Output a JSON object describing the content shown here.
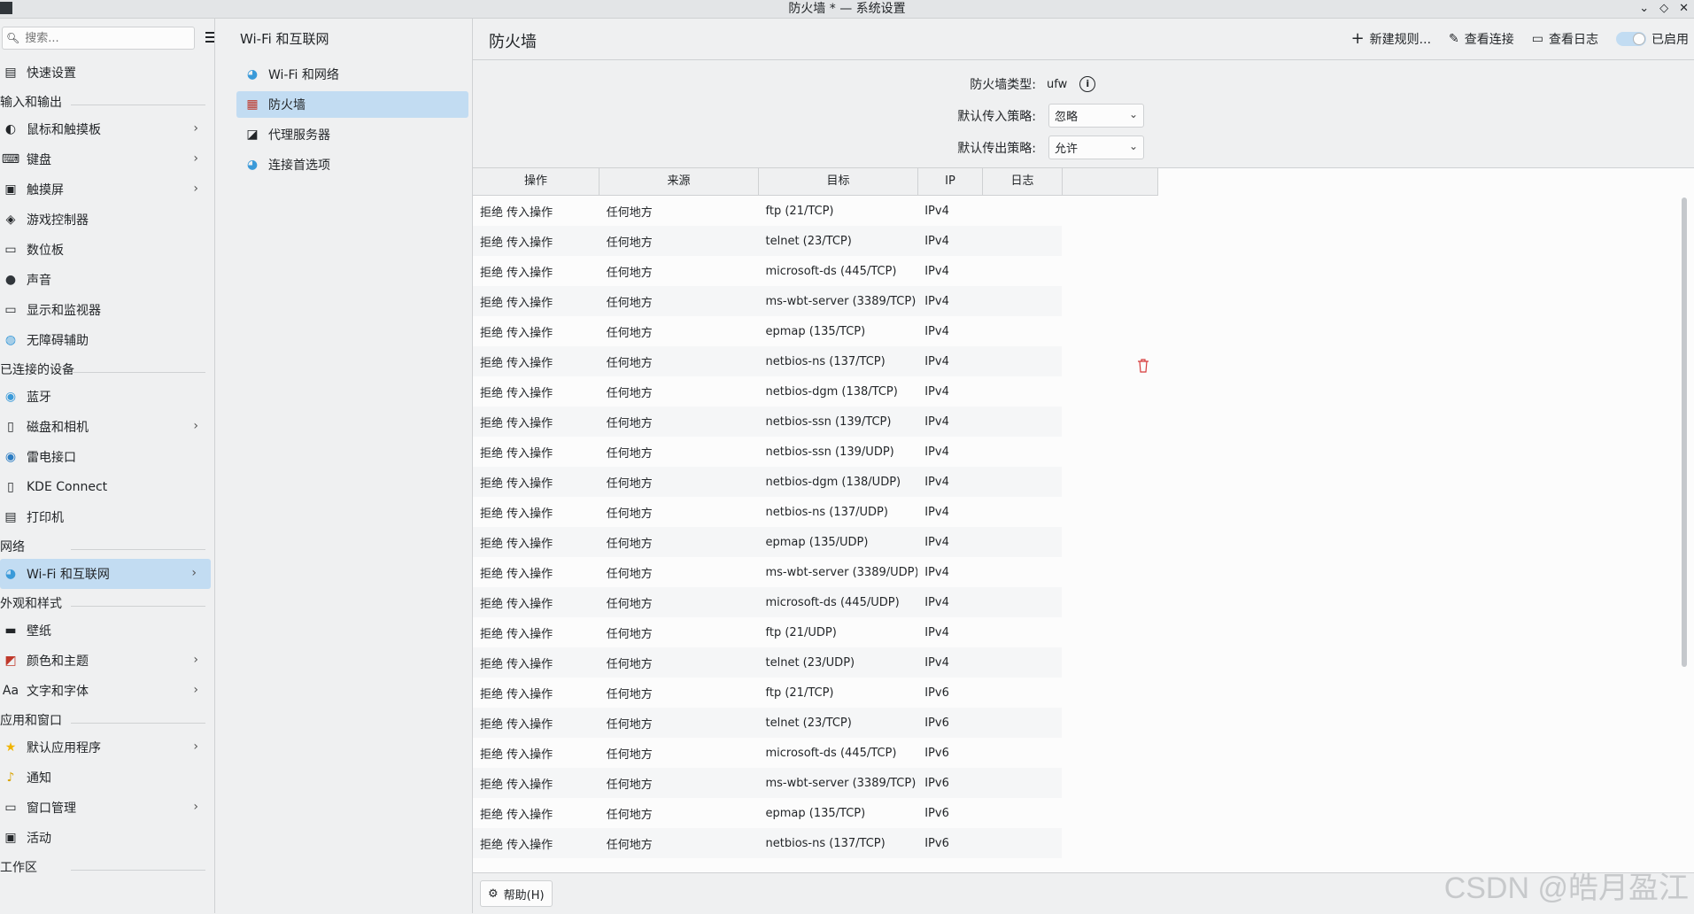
{
  "window": {
    "title": "防火墙 * — 系统设置"
  },
  "sidebar": {
    "search_placeholder": "搜索...",
    "items": [
      {
        "kind": "item",
        "label": "快速设置",
        "icon": "quick-settings-icon",
        "chevron": false
      },
      {
        "kind": "section",
        "label": "输入和输出"
      },
      {
        "kind": "item",
        "label": "鼠标和触摸板",
        "icon": "mouse-icon",
        "chevron": true
      },
      {
        "kind": "item",
        "label": "键盘",
        "icon": "keyboard-icon",
        "chevron": true
      },
      {
        "kind": "item",
        "label": "触摸屏",
        "icon": "touchscreen-icon",
        "chevron": true
      },
      {
        "kind": "item",
        "label": "游戏控制器",
        "icon": "gamepad-icon",
        "chevron": false
      },
      {
        "kind": "item",
        "label": "数位板",
        "icon": "tablet-icon",
        "chevron": false
      },
      {
        "kind": "item",
        "label": "声音",
        "icon": "speaker-icon",
        "chevron": false
      },
      {
        "kind": "item",
        "label": "显示和监视器",
        "icon": "monitor-icon",
        "chevron": false
      },
      {
        "kind": "item",
        "label": "无障碍辅助",
        "icon": "accessibility-icon",
        "chevron": false
      },
      {
        "kind": "section",
        "label": "已连接的设备"
      },
      {
        "kind": "item",
        "label": "蓝牙",
        "icon": "bluetooth-icon",
        "chevron": false
      },
      {
        "kind": "item",
        "label": "磁盘和相机",
        "icon": "disk-icon",
        "chevron": true
      },
      {
        "kind": "item",
        "label": "雷电接口",
        "icon": "thunderbolt-icon",
        "chevron": false
      },
      {
        "kind": "item",
        "label": "KDE Connect",
        "icon": "phone-icon",
        "chevron": false
      },
      {
        "kind": "item",
        "label": "打印机",
        "icon": "printer-icon",
        "chevron": false
      },
      {
        "kind": "section",
        "label": "网络"
      },
      {
        "kind": "item",
        "label": "Wi-Fi 和互联网",
        "icon": "globe-icon",
        "chevron": true,
        "selected": true
      },
      {
        "kind": "section",
        "label": "外观和样式"
      },
      {
        "kind": "item",
        "label": "壁纸",
        "icon": "wallpaper-icon",
        "chevron": false
      },
      {
        "kind": "item",
        "label": "颜色和主题",
        "icon": "palette-icon",
        "chevron": true
      },
      {
        "kind": "item",
        "label": "文字和字体",
        "icon": "font-icon",
        "chevron": true
      },
      {
        "kind": "section",
        "label": "应用和窗口"
      },
      {
        "kind": "item",
        "label": "默认应用程序",
        "icon": "star-icon",
        "chevron": true
      },
      {
        "kind": "item",
        "label": "通知",
        "icon": "bell-icon",
        "chevron": false
      },
      {
        "kind": "item",
        "label": "窗口管理",
        "icon": "window-icon",
        "chevron": true
      },
      {
        "kind": "item",
        "label": "活动",
        "icon": "activities-icon",
        "chevron": false
      },
      {
        "kind": "section",
        "label": "工作区"
      }
    ]
  },
  "midpanel": {
    "title": "Wi-Fi 和互联网",
    "items": [
      {
        "label": "Wi-Fi 和网络",
        "icon": "globe-icon"
      },
      {
        "label": "防火墙",
        "icon": "firewall-icon",
        "selected": true
      },
      {
        "label": "代理服务器",
        "icon": "proxy-icon"
      },
      {
        "label": "连接首选项",
        "icon": "globe-icon"
      }
    ]
  },
  "main": {
    "title": "防火墙",
    "toolbar": {
      "new_rule": "新建规则...",
      "view_connections": "查看连接",
      "view_log": "查看日志",
      "enabled": "已启用"
    },
    "form": {
      "type_label": "防火墙类型:",
      "type_value": "ufw",
      "incoming_label": "默认传入策略:",
      "incoming_value": "忽略",
      "outgoing_label": "默认传出策略:",
      "outgoing_value": "允许"
    },
    "table": {
      "headers": [
        "操作",
        "来源",
        "目标",
        "IP",
        "日志"
      ],
      "rows": [
        [
          "拒绝 传入操作",
          "任何地方",
          "ftp (21/TCP)",
          "IPv4"
        ],
        [
          "拒绝 传入操作",
          "任何地方",
          "telnet (23/TCP)",
          "IPv4"
        ],
        [
          "拒绝 传入操作",
          "任何地方",
          "microsoft-ds (445/TCP)",
          "IPv4"
        ],
        [
          "拒绝 传入操作",
          "任何地方",
          "ms-wbt-server (3389/TCP)",
          "IPv4"
        ],
        [
          "拒绝 传入操作",
          "任何地方",
          "epmap (135/TCP)",
          "IPv4"
        ],
        [
          "拒绝 传入操作",
          "任何地方",
          "netbios-ns (137/TCP)",
          "IPv4"
        ],
        [
          "拒绝 传入操作",
          "任何地方",
          "netbios-dgm (138/TCP)",
          "IPv4"
        ],
        [
          "拒绝 传入操作",
          "任何地方",
          "netbios-ssn (139/TCP)",
          "IPv4"
        ],
        [
          "拒绝 传入操作",
          "任何地方",
          "netbios-ssn (139/UDP)",
          "IPv4"
        ],
        [
          "拒绝 传入操作",
          "任何地方",
          "netbios-dgm (138/UDP)",
          "IPv4"
        ],
        [
          "拒绝 传入操作",
          "任何地方",
          "netbios-ns (137/UDP)",
          "IPv4"
        ],
        [
          "拒绝 传入操作",
          "任何地方",
          "epmap (135/UDP)",
          "IPv4"
        ],
        [
          "拒绝 传入操作",
          "任何地方",
          "ms-wbt-server (3389/UDP)",
          "IPv4"
        ],
        [
          "拒绝 传入操作",
          "任何地方",
          "microsoft-ds (445/UDP)",
          "IPv4"
        ],
        [
          "拒绝 传入操作",
          "任何地方",
          "ftp (21/UDP)",
          "IPv4"
        ],
        [
          "拒绝 传入操作",
          "任何地方",
          "telnet (23/UDP)",
          "IPv4"
        ],
        [
          "拒绝 传入操作",
          "任何地方",
          "ftp (21/TCP)",
          "IPv6"
        ],
        [
          "拒绝 传入操作",
          "任何地方",
          "telnet (23/TCP)",
          "IPv6"
        ],
        [
          "拒绝 传入操作",
          "任何地方",
          "microsoft-ds (445/TCP)",
          "IPv6"
        ],
        [
          "拒绝 传入操作",
          "任何地方",
          "ms-wbt-server (3389/TCP)",
          "IPv6"
        ],
        [
          "拒绝 传入操作",
          "任何地方",
          "epmap (135/TCP)",
          "IPv6"
        ],
        [
          "拒绝 传入操作",
          "任何地方",
          "netbios-ns (137/TCP)",
          "IPv6"
        ]
      ]
    }
  },
  "footer": {
    "help": "帮助(H)"
  },
  "watermark": "CSDN @皓月盈江",
  "colors": {
    "accent": "#c2dcf2",
    "delete": "#d63a3a"
  }
}
